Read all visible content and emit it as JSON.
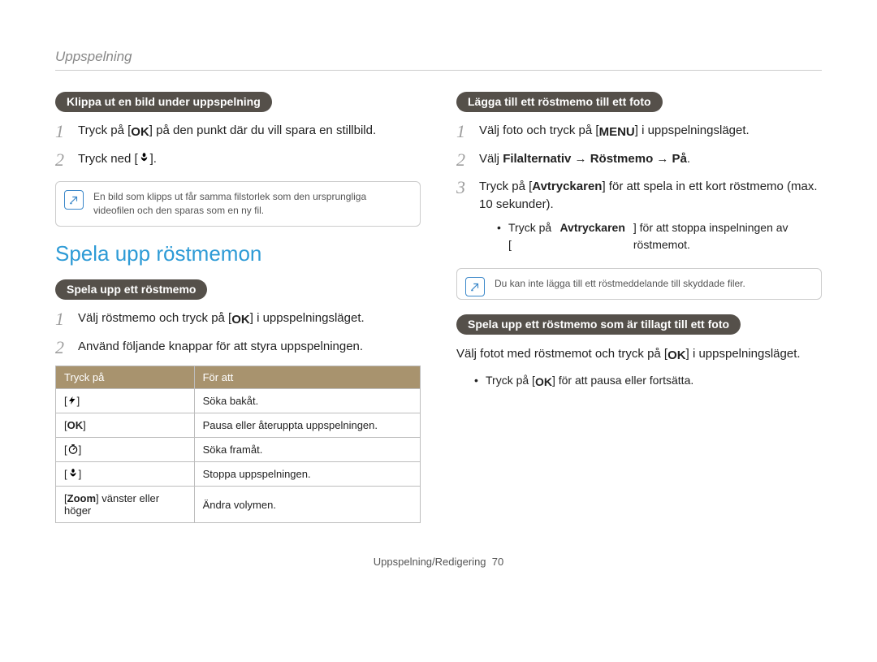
{
  "breadcrumb": "Uppspelning",
  "left": {
    "pill1": "Klippa ut en bild under uppspelning",
    "steps1": [
      {
        "pre": "Tryck på [",
        "icon": "ok",
        "post": "] på den punkt där du vill spara en stillbild."
      },
      {
        "pre": "Tryck ned [",
        "icon": "macro",
        "post": "]."
      }
    ],
    "note1": "En bild som klipps ut får samma filstorlek som den ursprungliga videofilen och den sparas som en ny fil.",
    "section_title": "Spela upp röstmemon",
    "pill2": "Spela upp ett röstmemo",
    "steps2": [
      {
        "pre": "Välj röstmemo och tryck på [",
        "icon": "ok",
        "post": "] i uppspelningsläget."
      },
      {
        "text": "Använd följande knappar för att styra uppspelningen."
      }
    ],
    "table": {
      "headers": [
        "Tryck på",
        "För att"
      ],
      "rows": [
        {
          "icon": "flash",
          "action": "Söka bakåt."
        },
        {
          "icon": "ok",
          "action": "Pausa eller återuppta uppspelningen."
        },
        {
          "icon": "timer",
          "action": "Söka framåt."
        },
        {
          "icon": "macro",
          "action": "Stoppa uppspelningen."
        },
        {
          "label_pre": "[",
          "label_bold": "Zoom",
          "label_post": "] vänster eller höger",
          "action": "Ändra volymen."
        }
      ]
    }
  },
  "right": {
    "pill1": "Lägga till ett röstmemo till ett foto",
    "steps1": [
      {
        "pre": "Välj foto och tryck på [",
        "icon": "menu",
        "post": "] i uppspelningsläget."
      },
      {
        "html_pre": "Välj ",
        "bold_chain": "Filalternativ → Röstmemo → På",
        "post": "."
      },
      {
        "pre": "Tryck på [",
        "bold_inline": "Avtryckaren",
        "post": "] för att spela in ett kort röstmemo (max. 10 sekunder).",
        "sub_pre": "Tryck på [",
        "sub_bold": "Avtryckaren",
        "sub_post": "] för att stoppa inspelningen av röstmemot."
      }
    ],
    "note1": "Du kan inte lägga till ett röstmeddelande till skyddade filer.",
    "pill2": "Spela upp ett röstmemo som är tillagt till ett foto",
    "para_pre": "Välj fotot med röstmemot och tryck på [",
    "para_icon": "ok",
    "para_post": "] i uppspelningsläget.",
    "bullet_pre": "Tryck på [",
    "bullet_icon": "ok",
    "bullet_post": "] för att pausa eller fortsätta."
  },
  "footer": {
    "label": "Uppspelning/Redigering",
    "page": "70"
  }
}
